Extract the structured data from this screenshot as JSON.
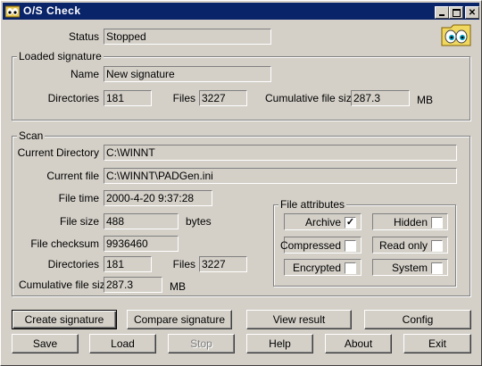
{
  "window": {
    "title": "O/S Check"
  },
  "status": {
    "label": "Status",
    "value": "Stopped"
  },
  "loaded_signature": {
    "title": "Loaded signature",
    "name_label": "Name",
    "name_value": "New signature",
    "directories_label": "Directories",
    "directories_value": "181",
    "files_label": "Files",
    "files_value": "3227",
    "cumulative_label": "Cumulative file size",
    "cumulative_value": "287.3",
    "cumulative_unit": "MB"
  },
  "scan": {
    "title": "Scan",
    "current_directory_label": "Current Directory",
    "current_directory_value": "C:\\WINNT",
    "current_file_label": "Current file",
    "current_file_value": "C:\\WINNT\\PADGen.ini",
    "file_time_label": "File time",
    "file_time_value": "2000-4-20 9:37:28",
    "file_size_label": "File size",
    "file_size_value": "488",
    "file_size_unit": "bytes",
    "file_checksum_label": "File checksum",
    "file_checksum_value": "9936460",
    "directories_label": "Directories",
    "directories_value": "181",
    "files_label": "Files",
    "files_value": "3227",
    "cumulative_label": "Cumulative file size",
    "cumulative_value": "287.3",
    "cumulative_unit": "MB"
  },
  "attributes": {
    "title": "File attributes",
    "archive": {
      "label": "Archive",
      "checked": true
    },
    "hidden": {
      "label": "Hidden",
      "checked": false
    },
    "compressed": {
      "label": "Compressed",
      "checked": false
    },
    "read_only": {
      "label": "Read only",
      "checked": false
    },
    "encrypted": {
      "label": "Encrypted",
      "checked": false
    },
    "system": {
      "label": "System",
      "checked": false
    }
  },
  "buttons": {
    "create_signature": "Create signature",
    "compare_signature": "Compare signature",
    "view_result": "View result",
    "config": "Config",
    "save": "Save",
    "load": "Load",
    "stop": "Stop",
    "help": "Help",
    "about": "About",
    "exit": "Exit"
  },
  "check_mark": "✓",
  "icons": {
    "app": "eyes-icon",
    "logo": "eyes-folder-icon"
  }
}
